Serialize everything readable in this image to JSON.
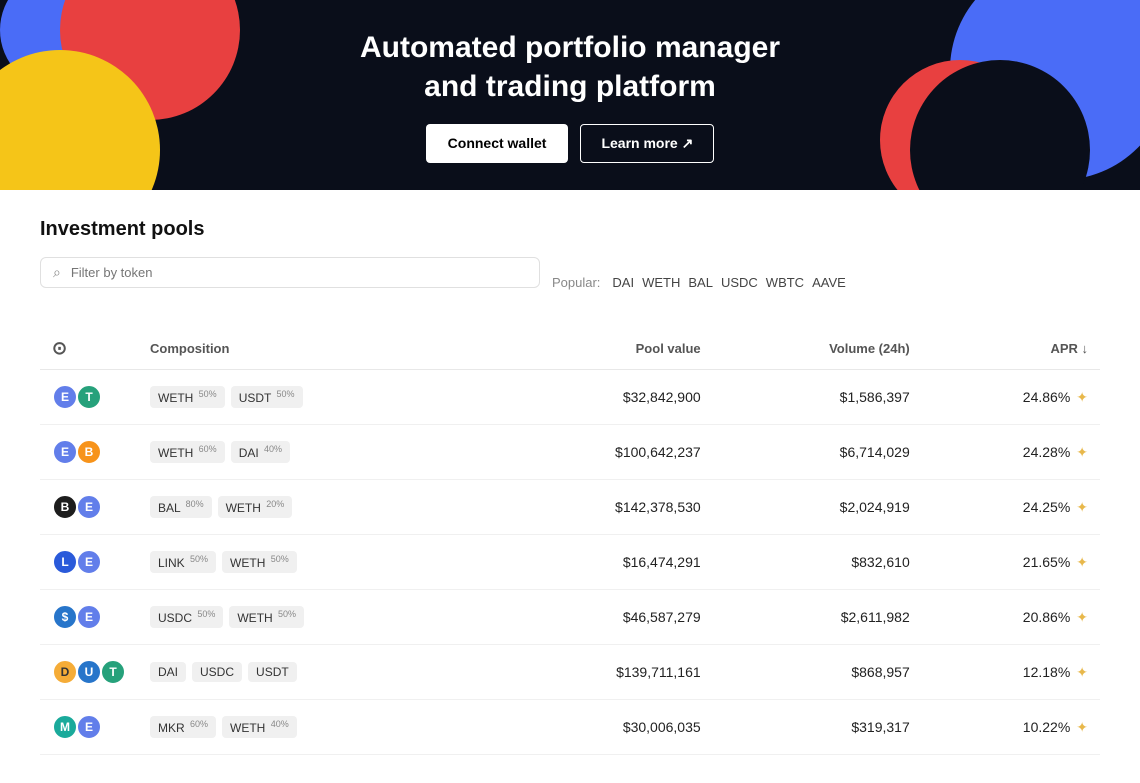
{
  "hero": {
    "title_line1": "Automated portfolio manager",
    "title_line2": "and trading platform",
    "connect_wallet": "Connect wallet",
    "learn_more": "Learn more ↗"
  },
  "investment_pools": {
    "title": "Investment pools",
    "filter_placeholder": "Filter by token",
    "popular_label": "Popular:",
    "popular_tokens": [
      "DAI",
      "WETH",
      "BAL",
      "USDC",
      "WBTC",
      "AAVE"
    ],
    "columns": {
      "icons": "",
      "composition": "Composition",
      "pool_value": "Pool value",
      "volume": "Volume (24h)",
      "apr": "APR ↓"
    },
    "rows": [
      {
        "icon1_class": "ti-eth",
        "icon1_label": "ETH",
        "icon2_class": "ti-green",
        "icon2_label": "T",
        "badges": [
          {
            "label": "WETH",
            "pct": "50%"
          },
          {
            "label": "USDT",
            "pct": "50%"
          }
        ],
        "pool_value": "$32,842,900",
        "volume": "$1,586,397",
        "apr": "24.86%"
      },
      {
        "icon1_class": "ti-eth",
        "icon1_label": "ETH",
        "icon2_class": "ti-orange",
        "icon2_label": "B",
        "badges": [
          {
            "label": "WETH",
            "pct": "60%"
          },
          {
            "label": "DAI",
            "pct": "40%"
          }
        ],
        "pool_value": "$100,642,237",
        "volume": "$6,714,029",
        "apr": "24.28%"
      },
      {
        "icon1_class": "ti-bal",
        "icon1_label": "B",
        "icon2_class": "ti-eth",
        "icon2_label": "ETH",
        "badges": [
          {
            "label": "BAL",
            "pct": "80%"
          },
          {
            "label": "WETH",
            "pct": "20%"
          }
        ],
        "pool_value": "$142,378,530",
        "volume": "$2,024,919",
        "apr": "24.25%"
      },
      {
        "icon1_class": "ti-link",
        "icon1_label": "L",
        "icon2_class": "ti-eth",
        "icon2_label": "ETH",
        "badges": [
          {
            "label": "LINK",
            "pct": "50%"
          },
          {
            "label": "WETH",
            "pct": "50%"
          }
        ],
        "pool_value": "$16,474,291",
        "volume": "$832,610",
        "apr": "21.65%"
      },
      {
        "icon1_class": "ti-usdc",
        "icon1_label": "$",
        "icon2_class": "ti-eth",
        "icon2_label": "ETH",
        "badges": [
          {
            "label": "USDC",
            "pct": "50%"
          },
          {
            "label": "WETH",
            "pct": "50%"
          }
        ],
        "pool_value": "$46,587,279",
        "volume": "$2,611,982",
        "apr": "20.86%"
      },
      {
        "icon1_class": "ti-multi1",
        "icon1_label": "D",
        "icon2_class": "ti-multi2",
        "icon2_label": "U",
        "icon3_class": "ti-multi3",
        "icon3_label": "T",
        "badges": [
          {
            "label": "DAI",
            "pct": ""
          },
          {
            "label": "USDC",
            "pct": ""
          },
          {
            "label": "USDT",
            "pct": ""
          }
        ],
        "pool_value": "$139,711,161",
        "volume": "$868,957",
        "apr": "12.18%"
      },
      {
        "icon1_class": "ti-mkr",
        "icon1_label": "M",
        "icon2_class": "ti-eth",
        "icon2_label": "ETH",
        "badges": [
          {
            "label": "MKR",
            "pct": "60%"
          },
          {
            "label": "WETH",
            "pct": "40%"
          }
        ],
        "pool_value": "$30,006,035",
        "volume": "$319,317",
        "apr": "10.22%"
      }
    ]
  }
}
